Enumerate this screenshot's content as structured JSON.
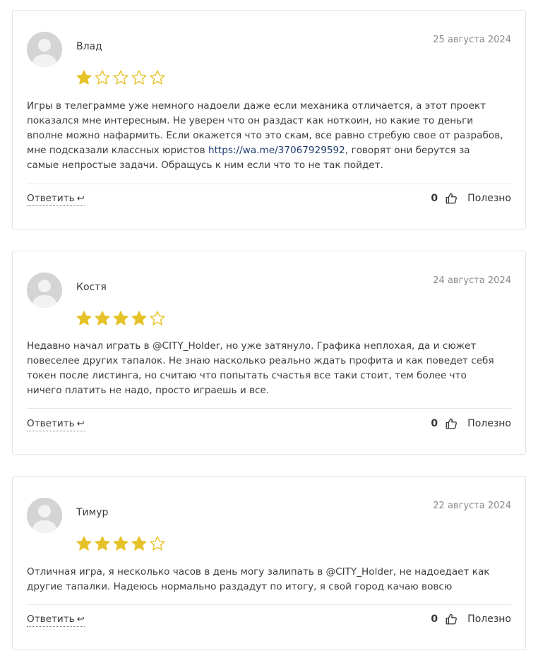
{
  "reviews": [
    {
      "author": "Влад",
      "date": "25 августа 2024",
      "rating": 1,
      "text_before": "Игры в телеграмме уже немного надоели даже если механика отличается, а этот проект показался мне интересным. Не уверен что он раздаст как ноткоин, но какие то деньги вполне можно нафармить. Если окажется что это скам, все равно стребую свое от разрабов, мне подсказали классных юристов ",
      "link": "https://wa.me/37067929592",
      "text_after": ", говорят они берутся за самые непростые задачи. Обращусь к ним если что то не так пойдет.",
      "reply_label": "Ответить",
      "reply_icon": "↩",
      "likes": "0",
      "useful_label": "Полезно"
    },
    {
      "author": "Костя",
      "date": "24 августа 2024",
      "rating": 4,
      "text_before": "Недавно начал играть в @CITY_Holder, но уже затянуло. Графика неплохая, да и сюжет повеселее других тапалок. Не знаю насколько реально ждать профита и как поведет себя токен после листинга, но считаю что попытать счастья все таки стоит, тем более что ничего платить не надо, просто играешь и все.",
      "reply_label": "Ответить",
      "reply_icon": "↩",
      "likes": "0",
      "useful_label": "Полезно"
    },
    {
      "author": "Тимур",
      "date": "22 августа 2024",
      "rating": 4,
      "text_before": "Отличная игра, я несколько часов в день могу залипать в @CITY_Holder, не надоедает как другие тапалки. Надеюсь нормально раздадут по итогу, я свой город качаю вовсю",
      "reply_label": "Ответить",
      "reply_icon": "↩",
      "likes": "0",
      "useful_label": "Полезно"
    }
  ],
  "colors": {
    "star_filled": "#e6c229",
    "star_empty": "#e6c229",
    "link": "#1d3a6e"
  },
  "icons": {
    "avatar": "user-silhouette-icon",
    "star": "star-icon",
    "thumb": "thumbs-up-icon"
  }
}
